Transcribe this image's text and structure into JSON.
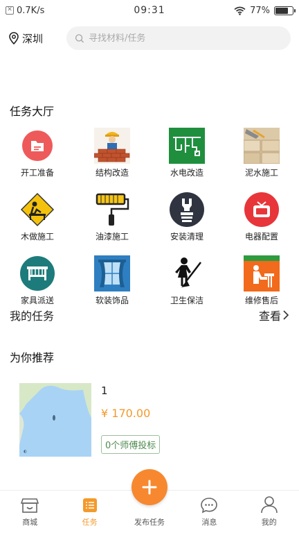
{
  "status_bar": {
    "network_speed": "0.7K/s",
    "time": "09:31",
    "battery_percent": "77%",
    "battery_level": 0.77
  },
  "header": {
    "location": "深圳",
    "search_placeholder": "寻找材料/任务"
  },
  "task_hall": {
    "title": "任务大厅",
    "items": [
      {
        "label": "开工准备",
        "icon": "folder-icon"
      },
      {
        "label": "结构改造",
        "icon": "bricklayer-icon"
      },
      {
        "label": "水电改造",
        "icon": "plumbing-icon"
      },
      {
        "label": "泥水施工",
        "icon": "tiling-icon"
      },
      {
        "label": "木做施工",
        "icon": "carpentry-warning-icon"
      },
      {
        "label": "油漆施工",
        "icon": "paint-roller-icon"
      },
      {
        "label": "安装清理",
        "icon": "installation-hand-icon"
      },
      {
        "label": "电器配置",
        "icon": "tv-icon"
      },
      {
        "label": "家具派送",
        "icon": "furniture-delivery-icon"
      },
      {
        "label": "软装饰品",
        "icon": "curtain-window-icon"
      },
      {
        "label": "卫生保洁",
        "icon": "cleaning-woman-icon"
      },
      {
        "label": "维修售后",
        "icon": "repair-worker-icon"
      }
    ]
  },
  "my_tasks": {
    "title": "我的任务",
    "view_label": "查看"
  },
  "recommend": {
    "title": "为你推荐",
    "card": {
      "title": "1",
      "price": "¥ 170.00",
      "bid_badge": "0个师傅投标"
    }
  },
  "tabbar": {
    "items": [
      {
        "label": "商城",
        "icon": "store-icon"
      },
      {
        "label": "任务",
        "icon": "task-list-icon"
      },
      {
        "label": "发布任务",
        "icon": "plus-icon"
      },
      {
        "label": "消息",
        "icon": "message-icon"
      },
      {
        "label": "我的",
        "icon": "user-icon"
      }
    ],
    "active_index": 1
  },
  "colors": {
    "accent": "#f7882f",
    "price": "#f39a2c",
    "badge": "#4f8a4f"
  }
}
